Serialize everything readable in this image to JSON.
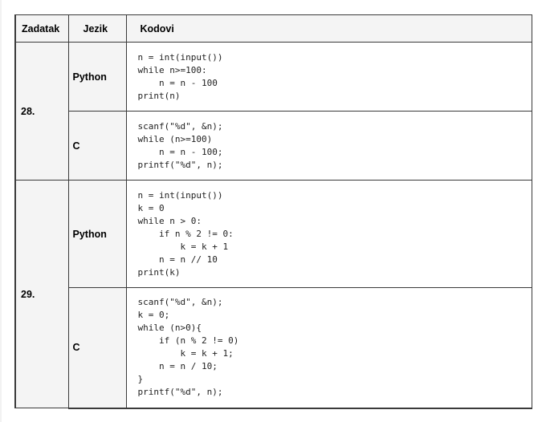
{
  "table": {
    "headers": {
      "task": "Zadatak",
      "language": "Jezik",
      "code": "Kodovi"
    },
    "tasks": [
      {
        "number": "28.",
        "entries": [
          {
            "language": "Python",
            "code": "n = int(input())\nwhile n>=100:\n    n = n - 100\nprint(n)"
          },
          {
            "language": "C",
            "code": "scanf(\"%d\", &n);\nwhile (n>=100)\n    n = n - 100;\nprintf(\"%d\", n);"
          }
        ]
      },
      {
        "number": "29.",
        "entries": [
          {
            "language": "Python",
            "code": "n = int(input())\nk = 0\nwhile n > 0:\n    if n % 2 != 0:\n        k = k + 1\n    n = n // 10\nprint(k)"
          },
          {
            "language": "C",
            "code": "scanf(\"%d\", &n);\nk = 0;\nwhile (n>0){\n    if (n % 2 != 0)\n        k = k + 1;\n    n = n / 10;\n}\nprintf(\"%d\", n);"
          }
        ]
      }
    ]
  }
}
